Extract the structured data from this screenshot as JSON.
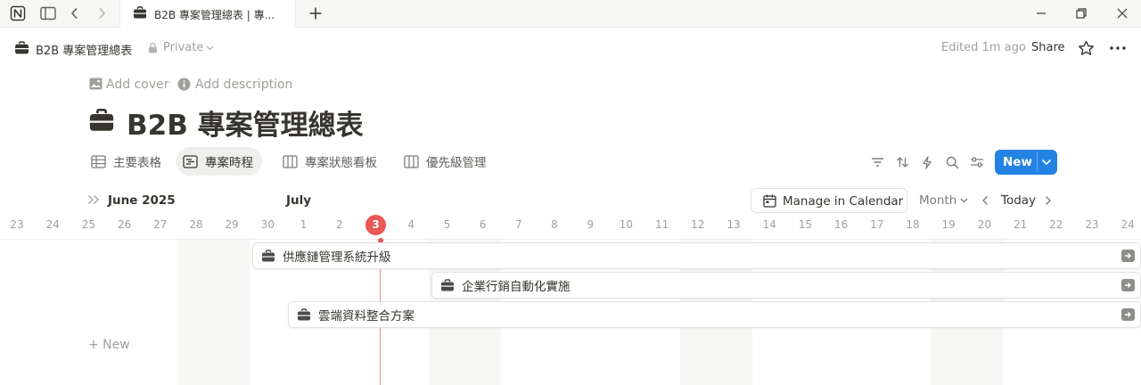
{
  "browser": {
    "tab_title": "B2B 專案管理總表 | 專...",
    "app_icon": "notion-logo"
  },
  "page_header": {
    "breadcrumb_title": "B2B 專案管理總表",
    "privacy": "Private",
    "edited": "Edited 1m ago",
    "share_label": "Share"
  },
  "page": {
    "add_cover": "Add cover",
    "add_description": "Add description",
    "title": "B2B 專案管理總表"
  },
  "views": [
    {
      "label": "主要表格",
      "icon": "table-icon",
      "active": false
    },
    {
      "label": "專案時程",
      "icon": "timeline-icon",
      "active": true
    },
    {
      "label": "專案狀態看板",
      "icon": "board-icon",
      "active": false
    },
    {
      "label": "優先級管理",
      "icon": "board-icon",
      "active": false
    }
  ],
  "toolbar": {
    "new_label": "New"
  },
  "timeline": {
    "month_label": "June 2025",
    "next_month_label": "July",
    "manage_calendar": "Manage in Calendar",
    "scale": "Month",
    "today_label": "Today",
    "today_day": "3",
    "days": [
      "23",
      "24",
      "25",
      "26",
      "27",
      "28",
      "29",
      "30",
      "1",
      "2",
      "3",
      "4",
      "5",
      "6",
      "7",
      "8",
      "9",
      "10",
      "11",
      "12",
      "13",
      "14",
      "15",
      "16",
      "17",
      "18",
      "19",
      "20",
      "21",
      "22",
      "23",
      "24"
    ],
    "add_new_label": "+ New",
    "items": [
      {
        "label": "供應鏈管理系統升級"
      },
      {
        "label": "企業行銷自動化實施"
      },
      {
        "label": "雲端資料整合方案"
      }
    ]
  },
  "colors": {
    "accent": "#2383e2",
    "today": "#eb5757",
    "text": "#37352f"
  }
}
